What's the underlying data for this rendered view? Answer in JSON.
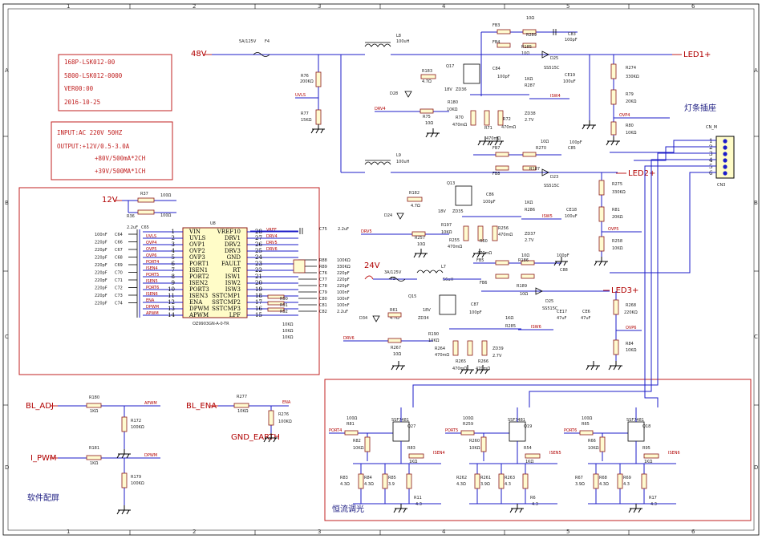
{
  "frame": {
    "columns": [
      "1",
      "2",
      "3",
      "4",
      "5",
      "6"
    ],
    "rows": [
      "A",
      "B",
      "C",
      "D"
    ]
  },
  "notes": {
    "part_block": [
      "168P-LSK012-00",
      "5800-LSK012-0000",
      "VER00:00",
      "2016-10-25"
    ],
    "spec_block": [
      "INPUT:AC 220V   50HZ",
      "OUTPUT:+12V/0.5-3.0A",
      "+80V/500mA*2CH",
      "+39V/500MA*1CH"
    ]
  },
  "sections": {
    "led_connector_title": "灯条插座",
    "dimming_title": "恒流调光",
    "software_title": "软件配屏"
  },
  "power": {
    "v48": "48V",
    "v12": "12V",
    "v24": "24V",
    "fuse4_label": "F4",
    "fuse4_rating": "5A/125V",
    "fuse5_label": "F5",
    "fuse5_rating": "3A/125V"
  },
  "ic": {
    "ref": "U8",
    "part": "OZ9903GN-A-0-TR",
    "left_pins": [
      {
        "num": "1",
        "name": "VIN"
      },
      {
        "num": "2",
        "name": "UVLS"
      },
      {
        "num": "3",
        "name": "OVP1"
      },
      {
        "num": "4",
        "name": "OVP2"
      },
      {
        "num": "5",
        "name": "OVP3"
      },
      {
        "num": "6",
        "name": "PORT1"
      },
      {
        "num": "7",
        "name": "ISEN1"
      },
      {
        "num": "8",
        "name": "PORT2"
      },
      {
        "num": "9",
        "name": "ISEN2"
      },
      {
        "num": "10",
        "name": "PORT3"
      },
      {
        "num": "11",
        "name": "ISEN3"
      },
      {
        "num": "12",
        "name": "ENA"
      },
      {
        "num": "13",
        "name": "DPWM"
      },
      {
        "num": "14",
        "name": "APWM"
      }
    ],
    "right_pins": [
      {
        "num": "28",
        "name": "VREF10"
      },
      {
        "num": "27",
        "name": "DRV1"
      },
      {
        "num": "26",
        "name": "DRV2"
      },
      {
        "num": "25",
        "name": "DRV3"
      },
      {
        "num": "24",
        "name": "GND"
      },
      {
        "num": "23",
        "name": "FAULT"
      },
      {
        "num": "22",
        "name": "RT"
      },
      {
        "num": "21",
        "name": "ISW1"
      },
      {
        "num": "20",
        "name": "ISW2"
      },
      {
        "num": "19",
        "name": "ISW3"
      },
      {
        "num": "18",
        "name": "SSTCMP1"
      },
      {
        "num": "17",
        "name": "SSTCMP2"
      },
      {
        "num": "16",
        "name": "SSTCMP3"
      },
      {
        "num": "15",
        "name": "LPF"
      }
    ]
  },
  "ic_nets_left": [
    "UVLS",
    "OVP4",
    "OVP5",
    "OVP6",
    "PORT4",
    "ISEN4",
    "PORT5",
    "ISEN5",
    "PORT6",
    "ISEN6",
    "ENA",
    "DPWM",
    "APWM"
  ],
  "ic_nets_right": [
    "VREF",
    "DRV4",
    "DRV5",
    "DRV6"
  ],
  "ic_caps_left": [
    {
      "ref": "C64",
      "val": "100nF"
    },
    {
      "ref": "C66",
      "val": "220pF"
    },
    {
      "ref": "C67",
      "val": "220pF"
    },
    {
      "ref": "C68",
      "val": "220pF"
    },
    {
      "ref": "C69",
      "val": "220pF"
    },
    {
      "ref": "C70",
      "val": "220pF"
    },
    {
      "ref": "C71",
      "val": "220pF"
    },
    {
      "ref": "C72",
      "val": "220pF"
    },
    {
      "ref": "C73",
      "val": "220pF"
    },
    {
      "ref": "C74",
      "val": "220pF"
    }
  ],
  "ic_caps_right": [
    {
      "ref": "R88",
      "val": "100KΩ"
    },
    {
      "ref": "R89",
      "val": "330KΩ"
    },
    {
      "ref": "C76",
      "val": "220pF"
    },
    {
      "ref": "C77",
      "val": "220pF"
    },
    {
      "ref": "C78",
      "val": "220pF"
    },
    {
      "ref": "C79",
      "val": "100nF"
    },
    {
      "ref": "C80",
      "val": "100nF"
    },
    {
      "ref": "C81",
      "val": "100nF"
    },
    {
      "ref": "C82",
      "val": "2.2uF"
    }
  ],
  "ic_misc": {
    "r37": "R37",
    "r37v": "100Ω",
    "r36": "R36",
    "r36v": "100Ω",
    "c65": "C65",
    "c65v": "2.2uF",
    "c75": "C75",
    "c75v": "2.2uF",
    "r90": "R90",
    "r91": "R91",
    "r92": "R92",
    "r9xv": "10KΩ"
  },
  "connector": {
    "ref": "CN_M",
    "part": "CN3",
    "pins": [
      "1",
      "2",
      "3",
      "4",
      "5",
      "6"
    ]
  },
  "outputs": {
    "led1": "LED1+",
    "led2": "LED2+",
    "led3": "LED3+"
  },
  "ch1": {
    "l8": "L8",
    "l8v": "100uH",
    "r76": "R76",
    "r76v": "200KΩ",
    "r77": "R77",
    "r77v": "15KΩ",
    "uvls": "UVLS",
    "r183": "R183",
    "r183v": "4.7Ω",
    "q17": "Q17",
    "c84": "C84",
    "c84v": "100pF",
    "zd36": "ZD36",
    "zd36v": "18V",
    "d28": "D28",
    "drv4": "DRV4",
    "r75": "R75",
    "r75v": "10Ω",
    "r180": "R180",
    "r180v": "10KΩ",
    "r70": "R70",
    "r70v": "470mΩ",
    "r71": "R71",
    "r71v": "470mΩ",
    "r72": "R72",
    "r72v": "470mΩ",
    "zd38": "ZD38",
    "zd38v": "2.7V",
    "r287": "R287",
    "r287v": "1KΩ",
    "isw4": "ISW4",
    "fb3": "FB3",
    "fb4": "FB4",
    "r289": "R289",
    "r289v": "10Ω",
    "c83": "C83",
    "c83v": "100pF",
    "r185": "R185",
    "r185v": "10Ω",
    "d25": "D25",
    "d25v": "SS515C",
    "ce19": "CE19",
    "ce19v": "100uF",
    "r274": "R274",
    "r274v": "330KΩ",
    "r79": "R79",
    "r79v": "20KΩ",
    "ovp4": "OVP4",
    "r80": "R80",
    "r80v": "10KΩ"
  },
  "ch2": {
    "l9": "L9",
    "l9v": "100uH",
    "r182": "R182",
    "r182v": "4.7Ω",
    "q13": "Q13",
    "c86": "C86",
    "c86v": "100pF",
    "zd35": "ZD35",
    "zd35v": "18V",
    "d24": "D24",
    "drv5": "DRV5",
    "r257": "R257",
    "r257v": "10Ω",
    "r197": "R197",
    "r197v": "10KΩ",
    "r255": "R255",
    "r255v": "470mΩ",
    "r60": "R60",
    "r60v": "470mΩ",
    "r256": "R256",
    "r256v": "470mΩ",
    "zd37": "ZD37",
    "zd37v": "2.7V",
    "r286": "R286",
    "r286v": "1KΩ",
    "isw5": "ISW5",
    "fb7": "FB7",
    "fb8": "FB8",
    "r270": "R270",
    "r270v": "10Ω",
    "c85": "C85",
    "c85v": "100pF",
    "r187": "R187",
    "d23": "D23",
    "d23v": "SS515C",
    "ce18": "CE18",
    "ce18v": "100uF",
    "r275": "R275",
    "r275v": "330KΩ",
    "r81": "R81",
    "r81v": "20KΩ",
    "ovp5": "OVP5",
    "r258": "R258",
    "r258v": "10KΩ"
  },
  "ch3": {
    "l7": "L7",
    "l7v": "56uH",
    "r61": "R61",
    "r61v": "4.7Ω",
    "q15": "Q15",
    "c87": "C87",
    "c87v": "100pF",
    "zd34": "ZD34",
    "zd34v": "18V",
    "d34": "D34",
    "drv6": "DRV6",
    "r267": "R267",
    "r267v": "10Ω",
    "r190": "R190",
    "r190v": "10KΩ",
    "r264": "R264",
    "r264v": "470mΩ",
    "r265": "R265",
    "r265v": "470mΩ",
    "r266": "R266",
    "r266v": "470mΩ",
    "zd39": "ZD39",
    "zd39v": "2.7V",
    "r285": "R285",
    "r285v": "1KΩ",
    "isw6": "ISW6",
    "fb5": "FB5",
    "fb6": "FB6",
    "r186": "R186",
    "r186v": "10Ω",
    "c88": "C88",
    "c88v": "100pF",
    "r189": "R189",
    "r189v": "10Ω",
    "d25": "D25",
    "d25v": "SS515C",
    "ce17": "CE17",
    "ce17v": "47uF",
    "ce6": "CE6",
    "ce6v": "47uF",
    "r268": "R268",
    "r268v": "220KΩ",
    "ovp6": "OVP6",
    "r84": "R84",
    "r84v": "10KΩ"
  },
  "sw": {
    "bl_adj": "BL_ADJ",
    "r180": "R180",
    "r180v": "1KΩ",
    "apwm": "APWM",
    "r172": "R172",
    "r172v": "100KΩ",
    "i_pwm": "I_PWM",
    "r181": "R181",
    "r181v": "1KΩ",
    "dpwm": "DPWM",
    "r179": "R179",
    "r179v": "100KΩ",
    "bl_ena": "BL_ENA",
    "r277": "R277",
    "r277v": "10KΩ",
    "ena": "ENA",
    "r276": "R276",
    "r276v": "100KΩ",
    "gnd": "GND_EARTH"
  },
  "dim": [
    {
      "port": "PORT4",
      "r_in": "R81",
      "r_inv": "100Ω",
      "q": "Q27",
      "q2": "SSF7481",
      "r_pd": "R82",
      "r_pdv": "10KΩ",
      "r_sense": "R83",
      "isen": "ISEN4",
      "rs": [
        {
          "r": "R83",
          "v": "4.3Ω"
        },
        {
          "r": "R84",
          "v": "4.3Ω"
        },
        {
          "r": "R85",
          "v": "3.9"
        }
      ],
      "r_bot": "R11",
      "r_botv": "4.3"
    },
    {
      "port": "PORT5",
      "r_in": "R259",
      "r_inv": "100Ω",
      "q": "Q19",
      "q2": "SSF7481",
      "r_pd": "R260",
      "r_pdv": "10KΩ",
      "r_sense": "R54",
      "isen": "ISEN5",
      "rs": [
        {
          "r": "R262",
          "v": "4.3Ω"
        },
        {
          "r": "R261",
          "v": "3.9Ω"
        },
        {
          "r": "R263",
          "v": "4.3"
        }
      ],
      "r_bot": "R6",
      "r_botv": "4.3"
    },
    {
      "port": "PORT6",
      "r_in": "R65",
      "r_inv": "100Ω",
      "q": "Q18",
      "q2": "SSF7481",
      "r_pd": "R66",
      "r_pdv": "10KΩ",
      "r_sense": "R95",
      "isen": "ISEN6",
      "rs": [
        {
          "r": "R67",
          "v": "3.9Ω"
        },
        {
          "r": "R68",
          "v": "4.3Ω"
        },
        {
          "r": "R69",
          "v": "4.3"
        }
      ],
      "r_bot": "R17",
      "r_botv": "4.3"
    }
  ],
  "dim_sense_vals": [
    "1KΩ",
    "1KΩ",
    "1KΩ"
  ]
}
